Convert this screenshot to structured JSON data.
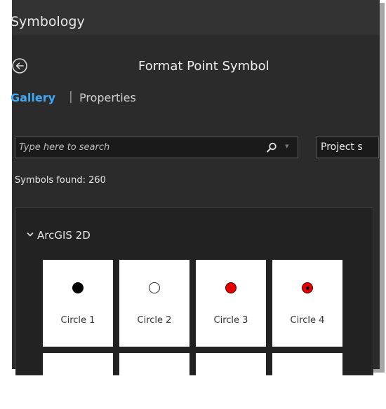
{
  "pane": {
    "title": "Symbology"
  },
  "subheader": {
    "title": "Format Point Symbol",
    "back_icon": "back-arrow-circle-icon"
  },
  "tabs": {
    "gallery": "Gallery",
    "separator": "|",
    "properties": "Properties"
  },
  "search": {
    "placeholder": "Type here to search",
    "icon": "search-icon",
    "project_label": "Project s"
  },
  "status": {
    "found": "Symbols found: 260"
  },
  "group": {
    "title": "ArcGIS 2D"
  },
  "symbols": [
    {
      "label": "Circle 1",
      "style": "black-filled"
    },
    {
      "label": "Circle 2",
      "style": "white-outlined"
    },
    {
      "label": "Circle 3",
      "style": "red-filled"
    },
    {
      "label": "Circle 4",
      "style": "red-with-black-center"
    }
  ],
  "colors": {
    "accent": "#3fa9f5",
    "background": "#2b2b2b",
    "symbol_red": "#e60000"
  }
}
